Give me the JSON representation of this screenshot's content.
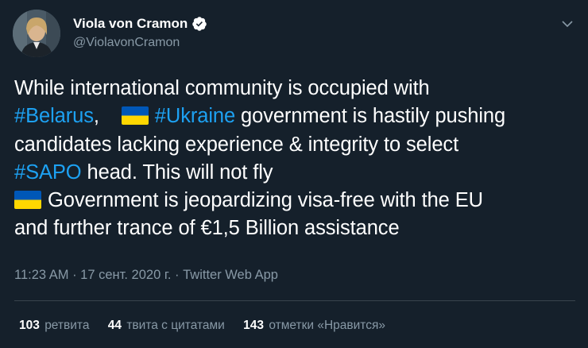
{
  "author": {
    "name": "Viola von Cramon",
    "handle": "@ViolavonCramon"
  },
  "tweet": {
    "l1": "While international community is occupied with",
    "l2_tag1": "#Belarus",
    "l2_comma": ",",
    "l2_tag2": "#Ukraine",
    "l2_rest": " government is hastily pushing",
    "l3": "candidates lacking experience & integrity to select",
    "l4_tag": "#SAPO",
    "l4_rest": " head. This will not fly",
    "l5": "Government is jeopardizing visa-free with the EU",
    "l6": "and further trance of €1,5 Billion assistance"
  },
  "meta": {
    "time": "11:23 AM",
    "sep1": " · ",
    "date": "17 сент. 2020 г.",
    "sep2": " · ",
    "source": "Twitter Web App"
  },
  "stats": {
    "retweets_count": "103",
    "retweets_label": "ретвита",
    "quotes_count": "44",
    "quotes_label": "твита с цитатами",
    "likes_count": "143",
    "likes_label": "отметки «Нравится»"
  },
  "colors": {
    "background": "#15202b",
    "link": "#1da1f2",
    "secondary_text": "#8899a6",
    "divider": "#38444d",
    "verified": "#ffffff",
    "flag_blue": "#0057b7",
    "flag_yellow": "#ffd700"
  },
  "icons": [
    "verified-badge-icon",
    "chevron-down-icon",
    "ukraine-flag-icon"
  ]
}
